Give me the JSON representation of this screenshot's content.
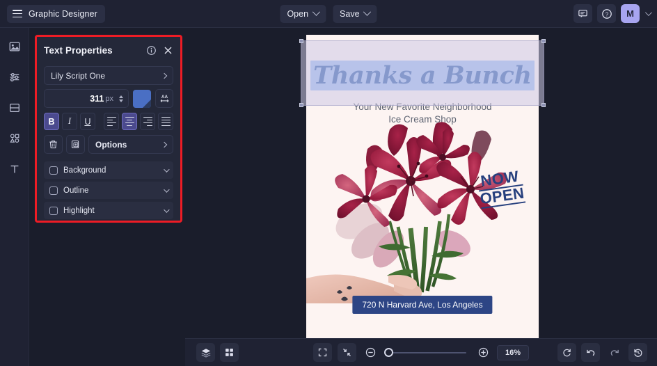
{
  "topbar": {
    "menu_icon": "hamburger-icon",
    "project_name": "Graphic Designer",
    "open_label": "Open",
    "save_label": "Save",
    "chat_icon": "chat-bubble-icon",
    "help_icon": "question-circle-icon",
    "avatar_initial": "M"
  },
  "rail": {
    "items": [
      {
        "icon": "image-icon",
        "name": "sidebar-item-images"
      },
      {
        "icon": "sliders-icon",
        "name": "sidebar-item-adjustments"
      },
      {
        "icon": "layout-icon",
        "name": "sidebar-item-layouts"
      },
      {
        "icon": "shapes-icon",
        "name": "sidebar-item-shapes"
      },
      {
        "icon": "text-icon",
        "name": "sidebar-item-text"
      }
    ]
  },
  "panel": {
    "title": "Text Properties",
    "info_icon": "info-circle-icon",
    "close_icon": "close-icon",
    "font_family": "Lily Script One",
    "font_size": "311",
    "font_size_unit": "px",
    "color_swatch": "#4a6fc4",
    "spacing_icon": "letter-spacing-icon",
    "bold_label": "B",
    "italic_label": "I",
    "underline_label": "U",
    "bold_active": true,
    "align_active": "center",
    "delete_icon": "trash-icon",
    "duplicate_icon": "duplicate-icon",
    "options_label": "Options",
    "accordions": [
      {
        "label": "Background",
        "checked": false
      },
      {
        "label": "Outline",
        "checked": false
      },
      {
        "label": "Highlight",
        "checked": false
      }
    ]
  },
  "canvas": {
    "headline": "Thanks a Bunch",
    "subtitle": "Your New Favorite Neighborhood\nIce Cream Shop",
    "subtitle_line1": "Your New Favorite Neighborhood",
    "subtitle_line2": "Ice Cream Shop",
    "badge_line1": "NOW",
    "badge_line2": "OPEN",
    "address": "720 N Harvard Ave, Los Angeles",
    "headline_color": "#2f5fae",
    "highlight_color": "#9dbdf0",
    "address_bar_color": "#2d4585",
    "poster_bg": "#fdf4f2"
  },
  "bottombar": {
    "layers_icon": "layers-icon",
    "grid_icon": "grid-icon",
    "fit_icon": "fit-screen-icon",
    "shrink_icon": "shrink-icon",
    "zoom_out_icon": "zoom-out-icon",
    "zoom_in_icon": "zoom-in-icon",
    "zoom_level": "16%",
    "zoom_slider_value": 4,
    "refresh_icon": "refresh-icon",
    "undo_icon": "undo-icon",
    "redo_icon": "redo-icon",
    "history_icon": "history-icon"
  }
}
